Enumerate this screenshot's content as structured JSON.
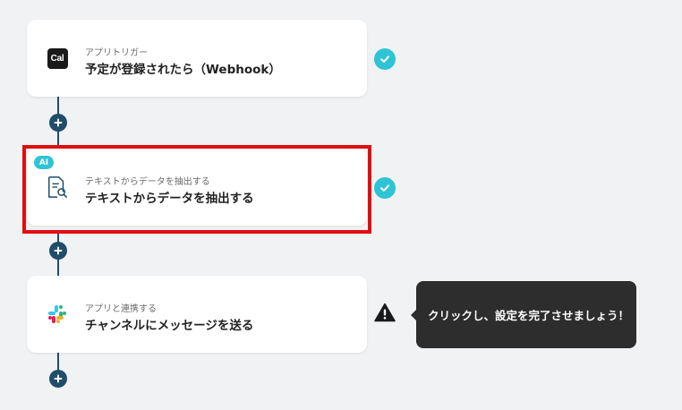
{
  "steps": [
    {
      "subtitle": "アプリトリガー",
      "title": "予定が登録されたら（Webhook）",
      "icon": "cal-logo-icon",
      "logo_text": "Cal",
      "status": "complete"
    },
    {
      "subtitle": "テキストからデータを抽出する",
      "title": "テキストからデータを抽出する",
      "icon": "document-search-icon",
      "badge": "AI",
      "status": "complete",
      "highlighted": true
    },
    {
      "subtitle": "アプリと連携する",
      "title": "チャンネルにメッセージを送る",
      "icon": "slack-icon",
      "status": "warning"
    }
  ],
  "tooltip": {
    "text": "クリックし、設定を完了させましょう！"
  },
  "colors": {
    "accent": "#2ec4d6",
    "flow_line": "#1f4d6b",
    "highlight": "#e00f0f",
    "tooltip_bg": "#2d2d2d",
    "background": "#f1f2f4"
  }
}
